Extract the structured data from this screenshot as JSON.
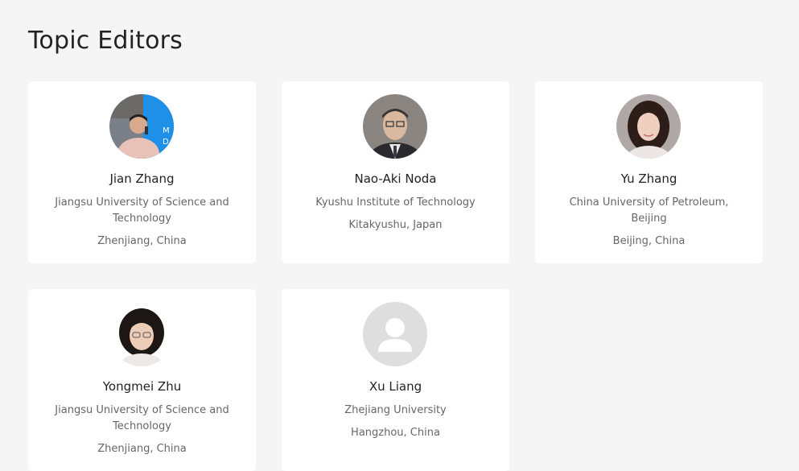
{
  "section": {
    "title": "Topic Editors"
  },
  "editors": [
    {
      "name": "Jian Zhang",
      "institution": "Jiangsu University of Science and Technology",
      "location": "Zhenjiang, China",
      "avatar": "person-photo"
    },
    {
      "name": "Nao-Aki Noda",
      "institution": "Kyushu Institute of Technology",
      "location": "Kitakyushu, Japan",
      "avatar": "person-photo"
    },
    {
      "name": "Yu Zhang",
      "institution": "China University of Petroleum, Beijing",
      "location": "Beijing, China",
      "avatar": "person-photo"
    },
    {
      "name": "Yongmei Zhu",
      "institution": "Jiangsu University of Science and Technology",
      "location": "Zhenjiang, China",
      "avatar": "person-photo"
    },
    {
      "name": "Xu Liang",
      "institution": "Zhejiang University",
      "location": "Hangzhou, China",
      "avatar": "placeholder-user-icon"
    }
  ]
}
